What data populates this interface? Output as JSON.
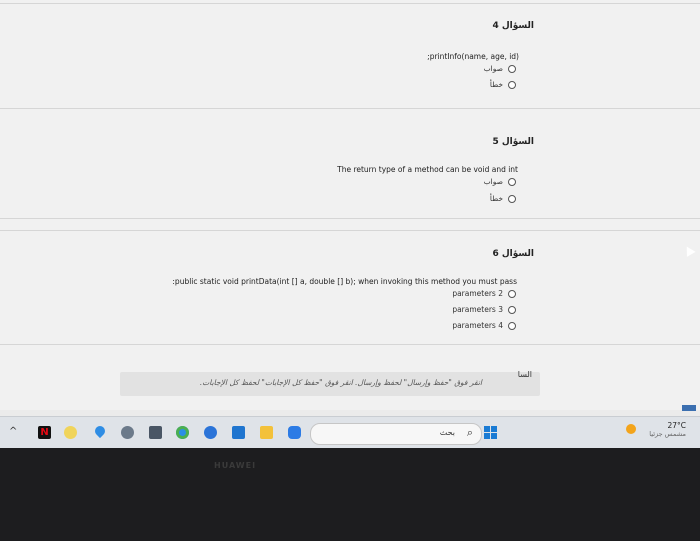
{
  "questions": [
    {
      "title": "السؤال 4",
      "text": ";printInfo(name, age, id)",
      "options": [
        "صواب",
        "خطأ"
      ]
    },
    {
      "title": "السؤال 5",
      "text": "The return type of a method can be void and int",
      "options": [
        "صواب",
        "خطأ"
      ]
    },
    {
      "title": "السؤال 6",
      "text": ":public static void printData(int [] a, double [] b); when invoking this method you must pass",
      "options": [
        "parameters 2",
        "parameters 3",
        "parameters 4"
      ]
    }
  ],
  "answer_hint": "انقر فوق \"حفظ وإرسال\" لحفظ وإرسال. انقر فوق \"حفظ كل الإجابات\" لحفظ كل الإجابات.",
  "answer_label": "السا",
  "taskbar": {
    "search_label": "بحث",
    "temperature": "27°C",
    "weather": "مشمس جزئيا",
    "apps": [
      "netflix-app",
      "chrome-beta-app",
      "maps-app",
      "settings-app",
      "calculator-app",
      "chrome-app",
      "edge-app",
      "mail-app",
      "file-explorer-app",
      "zoom-app",
      "tablet-app"
    ]
  },
  "bezel_brand": "HUAWEI",
  "colors": {
    "accent": "#1a7bd4",
    "netflix": "#d4151c",
    "chrome_beta": "#e04e3c"
  }
}
